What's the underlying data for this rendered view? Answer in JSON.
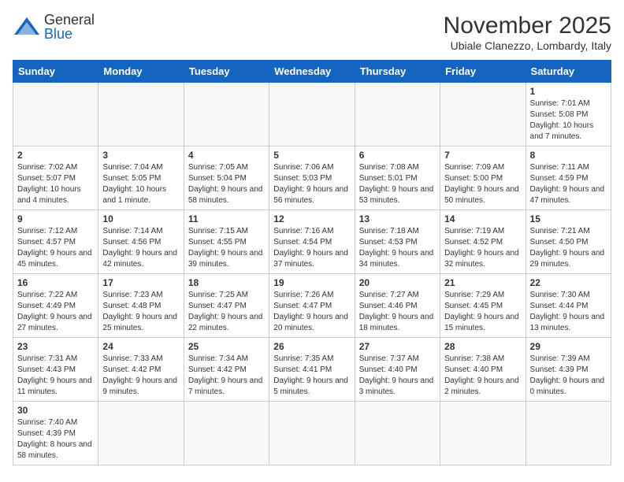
{
  "header": {
    "logo_general": "General",
    "logo_blue": "Blue",
    "month": "November 2025",
    "location": "Ubiale Clanezzo, Lombardy, Italy"
  },
  "weekdays": [
    "Sunday",
    "Monday",
    "Tuesday",
    "Wednesday",
    "Thursday",
    "Friday",
    "Saturday"
  ],
  "weeks": [
    [
      {
        "day": "",
        "info": ""
      },
      {
        "day": "",
        "info": ""
      },
      {
        "day": "",
        "info": ""
      },
      {
        "day": "",
        "info": ""
      },
      {
        "day": "",
        "info": ""
      },
      {
        "day": "",
        "info": ""
      },
      {
        "day": "1",
        "info": "Sunrise: 7:01 AM\nSunset: 5:08 PM\nDaylight: 10 hours and 7 minutes."
      }
    ],
    [
      {
        "day": "2",
        "info": "Sunrise: 7:02 AM\nSunset: 5:07 PM\nDaylight: 10 hours and 4 minutes."
      },
      {
        "day": "3",
        "info": "Sunrise: 7:04 AM\nSunset: 5:05 PM\nDaylight: 10 hours and 1 minute."
      },
      {
        "day": "4",
        "info": "Sunrise: 7:05 AM\nSunset: 5:04 PM\nDaylight: 9 hours and 58 minutes."
      },
      {
        "day": "5",
        "info": "Sunrise: 7:06 AM\nSunset: 5:03 PM\nDaylight: 9 hours and 56 minutes."
      },
      {
        "day": "6",
        "info": "Sunrise: 7:08 AM\nSunset: 5:01 PM\nDaylight: 9 hours and 53 minutes."
      },
      {
        "day": "7",
        "info": "Sunrise: 7:09 AM\nSunset: 5:00 PM\nDaylight: 9 hours and 50 minutes."
      },
      {
        "day": "8",
        "info": "Sunrise: 7:11 AM\nSunset: 4:59 PM\nDaylight: 9 hours and 47 minutes."
      }
    ],
    [
      {
        "day": "9",
        "info": "Sunrise: 7:12 AM\nSunset: 4:57 PM\nDaylight: 9 hours and 45 minutes."
      },
      {
        "day": "10",
        "info": "Sunrise: 7:14 AM\nSunset: 4:56 PM\nDaylight: 9 hours and 42 minutes."
      },
      {
        "day": "11",
        "info": "Sunrise: 7:15 AM\nSunset: 4:55 PM\nDaylight: 9 hours and 39 minutes."
      },
      {
        "day": "12",
        "info": "Sunrise: 7:16 AM\nSunset: 4:54 PM\nDaylight: 9 hours and 37 minutes."
      },
      {
        "day": "13",
        "info": "Sunrise: 7:18 AM\nSunset: 4:53 PM\nDaylight: 9 hours and 34 minutes."
      },
      {
        "day": "14",
        "info": "Sunrise: 7:19 AM\nSunset: 4:52 PM\nDaylight: 9 hours and 32 minutes."
      },
      {
        "day": "15",
        "info": "Sunrise: 7:21 AM\nSunset: 4:50 PM\nDaylight: 9 hours and 29 minutes."
      }
    ],
    [
      {
        "day": "16",
        "info": "Sunrise: 7:22 AM\nSunset: 4:49 PM\nDaylight: 9 hours and 27 minutes."
      },
      {
        "day": "17",
        "info": "Sunrise: 7:23 AM\nSunset: 4:48 PM\nDaylight: 9 hours and 25 minutes."
      },
      {
        "day": "18",
        "info": "Sunrise: 7:25 AM\nSunset: 4:47 PM\nDaylight: 9 hours and 22 minutes."
      },
      {
        "day": "19",
        "info": "Sunrise: 7:26 AM\nSunset: 4:47 PM\nDaylight: 9 hours and 20 minutes."
      },
      {
        "day": "20",
        "info": "Sunrise: 7:27 AM\nSunset: 4:46 PM\nDaylight: 9 hours and 18 minutes."
      },
      {
        "day": "21",
        "info": "Sunrise: 7:29 AM\nSunset: 4:45 PM\nDaylight: 9 hours and 15 minutes."
      },
      {
        "day": "22",
        "info": "Sunrise: 7:30 AM\nSunset: 4:44 PM\nDaylight: 9 hours and 13 minutes."
      }
    ],
    [
      {
        "day": "23",
        "info": "Sunrise: 7:31 AM\nSunset: 4:43 PM\nDaylight: 9 hours and 11 minutes."
      },
      {
        "day": "24",
        "info": "Sunrise: 7:33 AM\nSunset: 4:42 PM\nDaylight: 9 hours and 9 minutes."
      },
      {
        "day": "25",
        "info": "Sunrise: 7:34 AM\nSunset: 4:42 PM\nDaylight: 9 hours and 7 minutes."
      },
      {
        "day": "26",
        "info": "Sunrise: 7:35 AM\nSunset: 4:41 PM\nDaylight: 9 hours and 5 minutes."
      },
      {
        "day": "27",
        "info": "Sunrise: 7:37 AM\nSunset: 4:40 PM\nDaylight: 9 hours and 3 minutes."
      },
      {
        "day": "28",
        "info": "Sunrise: 7:38 AM\nSunset: 4:40 PM\nDaylight: 9 hours and 2 minutes."
      },
      {
        "day": "29",
        "info": "Sunrise: 7:39 AM\nSunset: 4:39 PM\nDaylight: 9 hours and 0 minutes."
      }
    ],
    [
      {
        "day": "30",
        "info": "Sunrise: 7:40 AM\nSunset: 4:39 PM\nDaylight: 8 hours and 58 minutes."
      },
      {
        "day": "",
        "info": ""
      },
      {
        "day": "",
        "info": ""
      },
      {
        "day": "",
        "info": ""
      },
      {
        "day": "",
        "info": ""
      },
      {
        "day": "",
        "info": ""
      },
      {
        "day": "",
        "info": ""
      }
    ]
  ]
}
